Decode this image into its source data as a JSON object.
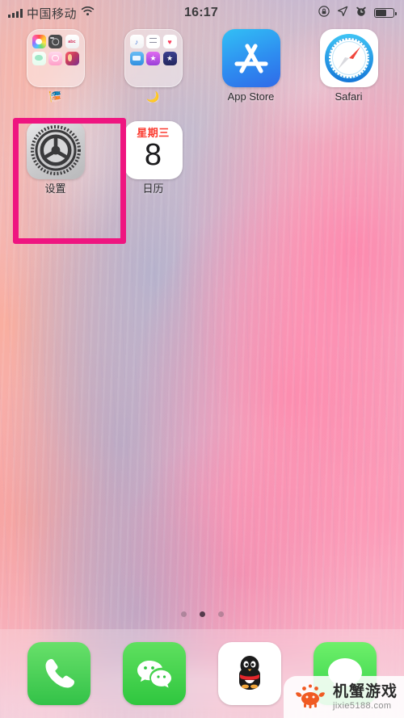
{
  "status_bar": {
    "carrier": "中国移动",
    "time": "16:17",
    "signal_icon": "cellular-bars-icon",
    "wifi_icon": "wifi-icon",
    "rotation_lock_icon": "rotation-lock-icon",
    "location_icon": "location-arrow-icon",
    "alarm_icon": "alarm-clock-icon",
    "battery_icon": "battery-icon",
    "battery_percent": 62
  },
  "colors": {
    "highlight": "#ef1580",
    "calendar_red": "#fb3b30",
    "wallpaper_pink": "#f6aec6",
    "wallpaper_lavender": "#b0b2ce",
    "watermark_orange": "#f05a22"
  },
  "home": {
    "rows": [
      [
        {
          "name": "folder-photo-apps",
          "type": "folder",
          "label": "🎏",
          "mini_icons": [
            "photos-icon",
            "camera-icon",
            "notes-icon",
            "snapchat-icon",
            "instagram-icon",
            "collage-icon"
          ]
        },
        {
          "name": "folder-media-apps",
          "type": "folder",
          "label": "🌙",
          "mini_icons": [
            "music-icon",
            "reminders-icon",
            "health-icon",
            "files-icon",
            "itunes-store-icon",
            "imovie-icon"
          ]
        },
        {
          "name": "app-store",
          "type": "app",
          "label": "App Store",
          "icon": "app-store-icon"
        },
        {
          "name": "safari",
          "type": "app",
          "label": "Safari",
          "icon": "safari-compass-icon"
        }
      ],
      [
        {
          "name": "settings",
          "type": "app",
          "label": "设置",
          "icon": "settings-gear-icon",
          "highlighted": true
        },
        {
          "name": "calendar",
          "type": "app",
          "label": "日历",
          "icon": "calendar-icon",
          "weekday": "星期三",
          "day": "8"
        }
      ]
    ]
  },
  "page_dots": {
    "count": 3,
    "active_index": 1
  },
  "dock": {
    "items": [
      {
        "name": "phone",
        "icon": "phone-handset-icon"
      },
      {
        "name": "wechat",
        "icon": "wechat-bubbles-icon"
      },
      {
        "name": "qq",
        "icon": "qq-penguin-icon"
      },
      {
        "name": "messages",
        "icon": "messages-bubble-icon"
      }
    ]
  },
  "watermark": {
    "logo": "crab-logo-icon",
    "title": "机蟹游戏",
    "url": "jixie5188.com"
  }
}
